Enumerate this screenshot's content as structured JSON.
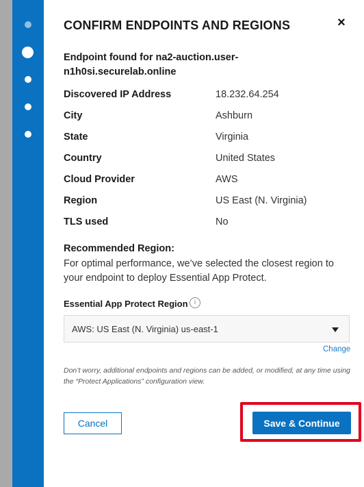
{
  "dialog": {
    "title": "CONFIRM ENDPOINTS AND REGIONS",
    "close_label": "×"
  },
  "endpoint": {
    "line1": "Endpoint found for na2-auction.user-",
    "line2": "n1h0si.securelab.online"
  },
  "details": [
    {
      "label": "Discovered IP Address",
      "value": "18.232.64.254"
    },
    {
      "label": "City",
      "value": "Ashburn"
    },
    {
      "label": "State",
      "value": "Virginia"
    },
    {
      "label": "Country",
      "value": "United States"
    },
    {
      "label": "Cloud Provider",
      "value": "AWS"
    },
    {
      "label": "Region",
      "value": "US East (N. Virginia)"
    },
    {
      "label": "TLS used",
      "value": "No"
    }
  ],
  "recommended": {
    "heading": "Recommended Region:",
    "text": "For optimal performance, we’ve selected the closest region to your endpoint to deploy Essential App Protect."
  },
  "region_select": {
    "label": "Essential App Protect Region",
    "info_icon": "i",
    "value": "AWS: US East (N. Virginia) us-east-1",
    "change_label": "Change"
  },
  "note": "Don’t worry, additional endpoints and regions can be added, or modified, at any time using the “Protect Applications” configuration view.",
  "actions": {
    "cancel_label": "Cancel",
    "save_label": "Save & Continue"
  },
  "colors": {
    "accent": "#0a72c0",
    "highlight": "#e0001b"
  }
}
